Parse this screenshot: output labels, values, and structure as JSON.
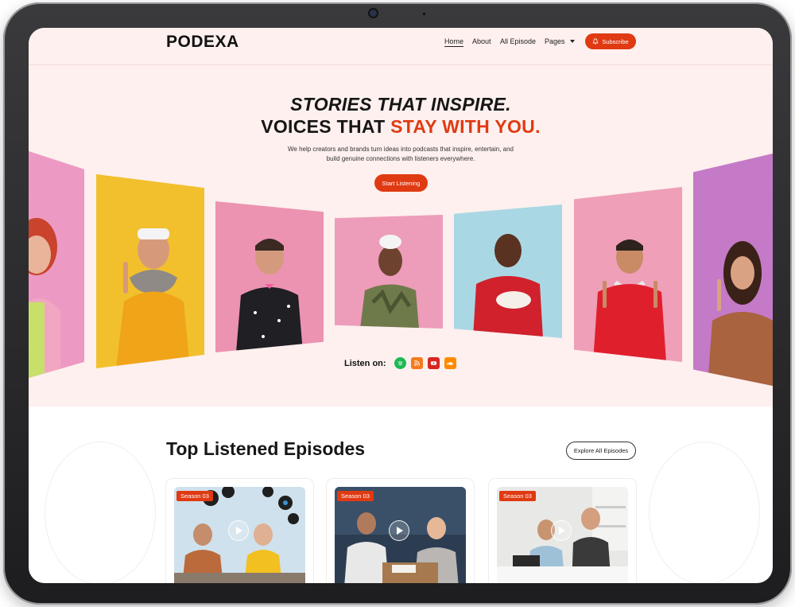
{
  "brand": {
    "name": "PODEXA"
  },
  "nav": {
    "items": [
      {
        "label": "Home",
        "active": true
      },
      {
        "label": "About"
      },
      {
        "label": "All Episode"
      },
      {
        "label": "Pages"
      }
    ],
    "subscribe_label": "Subscribe"
  },
  "hero": {
    "title_line1": "STORIES THAT INSPIRE.",
    "title_line2_part1": "VOICES THAT ",
    "title_line2_accent": "STAY WITH YOU.",
    "description": "We help creators and brands turn ideas into podcasts that inspire, entertain, and build genuine connections with listeners everywhere.",
    "cta_label": "Start Listening"
  },
  "listen_on": {
    "label": "Listen on:",
    "platforms": [
      "spotify-icon",
      "rss-icon",
      "youtube-icon",
      "soundcloud-icon"
    ]
  },
  "episodes_section": {
    "title": "Top Listened Episodes",
    "explore_label": "Explore All Episodes",
    "episodes": [
      {
        "season": "Season 03"
      },
      {
        "season": "Season 03"
      },
      {
        "season": "Season 03"
      }
    ]
  },
  "colors": {
    "accent": "#e03a12",
    "hero_bg": "#fdf0ee"
  }
}
